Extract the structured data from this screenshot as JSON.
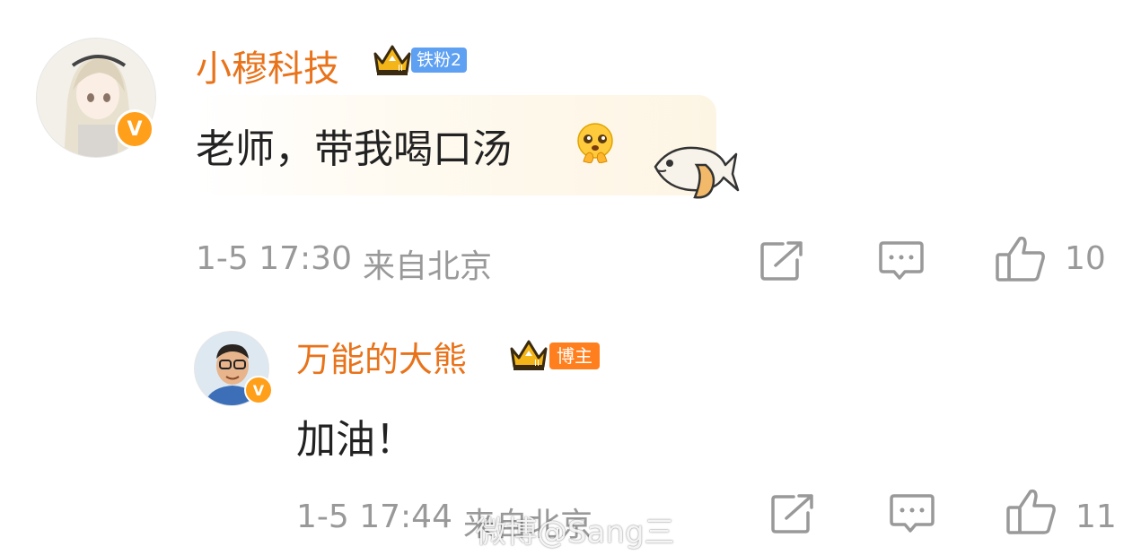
{
  "comments": [
    {
      "username": "小穆科技",
      "fan_badge": "铁粉2",
      "text": "老师，带我喝口汤",
      "time": "1-5 17:30",
      "location": "来自北京",
      "likes": "10"
    },
    {
      "username": "万能的大熊",
      "host_badge": "博主",
      "text": "加油！",
      "time": "1-5 17:44",
      "location": "来自北京",
      "likes": "11"
    }
  ],
  "watermark": "微博@Sang三",
  "colors": {
    "username": "#e8731a",
    "meta": "#999999",
    "fan_badge": "#5ea0f2",
    "host_badge": "#ff7f1e",
    "verified": "#ff9f1a"
  }
}
